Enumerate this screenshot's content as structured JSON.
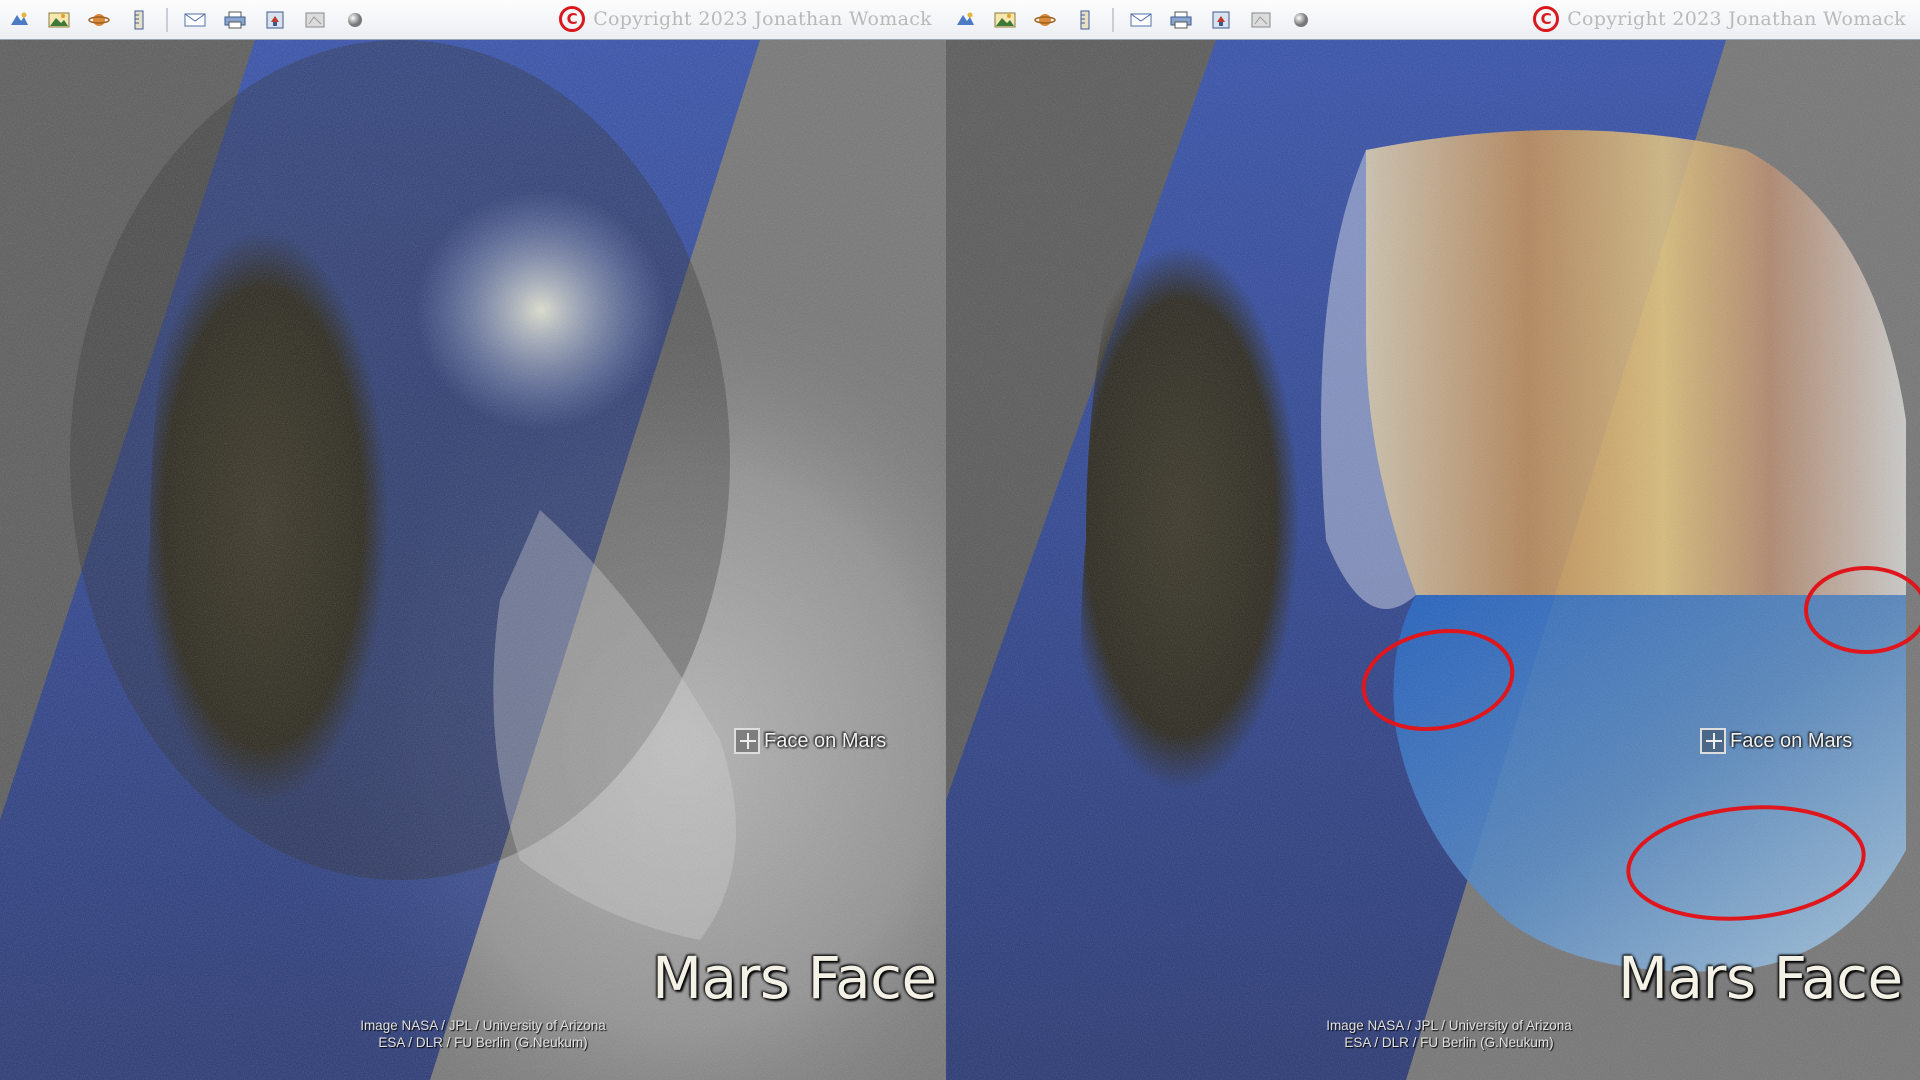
{
  "colors": {
    "copyright_red": "#d8191d",
    "highlight_circle": "#e0161d",
    "overlay_blue": "#3a5fc4",
    "overlay_warm": "#c9904f"
  },
  "toolbar": {
    "buttons": [
      {
        "name": "add-placemark-icon"
      },
      {
        "name": "add-image-overlay-icon"
      },
      {
        "name": "switch-planet-icon"
      },
      {
        "name": "ruler-icon"
      },
      {
        "name": "email-icon"
      },
      {
        "name": "print-icon"
      },
      {
        "name": "save-image-icon"
      },
      {
        "name": "view-in-maps-icon"
      },
      {
        "name": "sphere-icon"
      }
    ]
  },
  "left": {
    "copyright": "Copyright 2023 Jonathan Womack",
    "copyright_symbol": "C",
    "placemark_label": "Face on Mars",
    "title": "Mars Face",
    "credit_line1": "Image NASA / JPL / University of Arizona",
    "credit_line2": "ESA / DLR / FU Berlin (G.Neukum)"
  },
  "right": {
    "copyright": "Copyright 2023 Jonathan Womack",
    "copyright_symbol": "C",
    "placemark_label": "Face on Mars",
    "title": "Mars Face",
    "credit_line1": "Image NASA / JPL / University of Arizona",
    "credit_line2": "ESA / DLR / FU Berlin (G.Neukum)"
  }
}
